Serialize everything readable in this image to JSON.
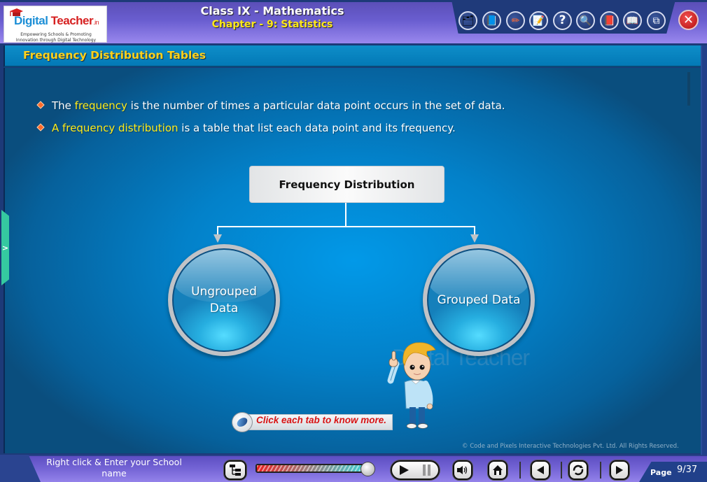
{
  "header": {
    "logo": {
      "brand_part1": "Digital",
      "brand_part2": " Teacher",
      "brand_suffix": ".in",
      "tagline_line1": "Empowering Schools & Promoting",
      "tagline_line2": "Innovation through Digital Technology"
    },
    "title": "Class IX - Mathematics",
    "subtitle": "Chapter - 9: Statistics",
    "toolbar": [
      {
        "name": "clock-folder-icon",
        "glyph": "🗂"
      },
      {
        "name": "book-icon",
        "glyph": "📘"
      },
      {
        "name": "drawing-tablet-icon",
        "glyph": "✏"
      },
      {
        "name": "notepad-icon",
        "glyph": "📝"
      },
      {
        "name": "help-icon",
        "glyph": "?"
      },
      {
        "name": "magnifier-icon",
        "glyph": "🔍"
      },
      {
        "name": "red-book-icon",
        "glyph": "📕"
      },
      {
        "name": "open-book-icon",
        "glyph": "📖"
      },
      {
        "name": "window-resize-icon",
        "glyph": "⧉"
      }
    ],
    "close_glyph": "✕"
  },
  "section": {
    "title": "Frequency Distribution Tables"
  },
  "bullets": [
    {
      "pre": "The ",
      "highlight": "frequency",
      "post": " is the number of times a particular data point occurs in the set of data."
    },
    {
      "pre": "",
      "highlight": "A frequency distribution",
      "post": " is a table that list each data point and its frequency."
    }
  ],
  "diagram": {
    "root": "Frequency Distribution",
    "children": [
      {
        "line1": "Ungrouped",
        "line2": "Data"
      },
      {
        "line1": "Grouped Data",
        "line2": ""
      }
    ]
  },
  "watermark": "Digital Teacher",
  "hint": "Click each tab to know more.",
  "copyright": "© Code and Pixels Interactive Technologies  Pvt. Ltd. All Rights Reserved.",
  "footer": {
    "school_name_prompt": "Right click & Enter your School name",
    "side_tab_glyph": ">",
    "progress_percent": 100,
    "page_label": "Page",
    "page_current": 9,
    "page_total": 37,
    "page_display": "9/37"
  },
  "colors": {
    "highlight": "#ffeb1a",
    "section_title": "#ffd21a",
    "hint_text": "#d81414",
    "bullet_diamond": "#ff6a2a"
  }
}
